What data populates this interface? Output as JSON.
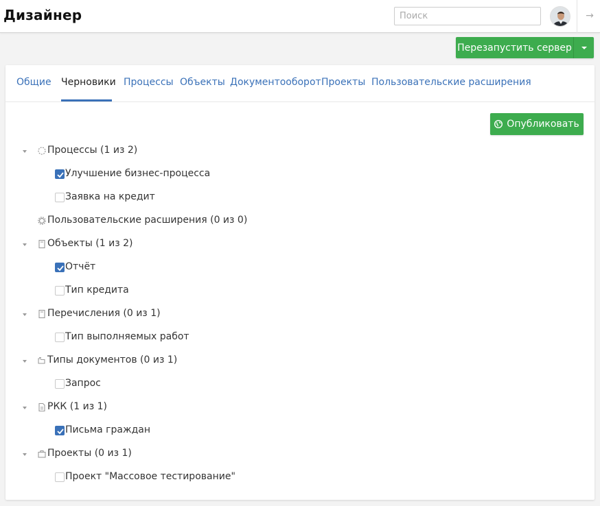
{
  "header": {
    "title": "Дизайнер",
    "search_placeholder": "Поиск"
  },
  "toolbar": {
    "restart_label": "Перезапустить сервер"
  },
  "tabs": [
    {
      "label": "Общие",
      "active": false
    },
    {
      "label": "Черновики",
      "active": true
    },
    {
      "label": "Процессы",
      "active": false
    },
    {
      "label": "Объекты",
      "active": false
    },
    {
      "label": "Документооборот",
      "active": false
    },
    {
      "label": "Проекты",
      "active": false
    },
    {
      "label": "Пользовательские расширения",
      "active": false
    }
  ],
  "publish_label": "Опубликовать",
  "tree": [
    {
      "label": "Процессы (1 из 2)",
      "icon": "process-icon",
      "items": [
        {
          "label": "Улучшение бизнес-процесса",
          "checked": true
        },
        {
          "label": "Заявка на кредит",
          "checked": false
        }
      ]
    },
    {
      "label": "Пользовательские расширения (0 из 0)",
      "icon": "gear-icon",
      "items": []
    },
    {
      "label": "Объекты (1 из 2)",
      "icon": "object-icon",
      "items": [
        {
          "label": "Отчёт",
          "checked": true
        },
        {
          "label": "Тип кредита",
          "checked": false
        }
      ]
    },
    {
      "label": "Перечисления (0 из 1)",
      "icon": "enum-icon",
      "items": [
        {
          "label": "Тип выполняемых работ",
          "checked": false
        }
      ]
    },
    {
      "label": "Типы документов (0 из 1)",
      "icon": "folder-icon",
      "items": [
        {
          "label": "Запрос",
          "checked": false
        }
      ]
    },
    {
      "label": "РКК (1 из 1)",
      "icon": "document-icon",
      "items": [
        {
          "label": "Письма граждан",
          "checked": true
        }
      ]
    },
    {
      "label": "Проекты (0 из 1)",
      "icon": "briefcase-icon",
      "items": [
        {
          "label": "Проект \"Массовое тестирование\"",
          "checked": false
        }
      ]
    }
  ],
  "colors": {
    "accent": "#3a71b8",
    "success": "#3dac4e",
    "background": "#f3f3f3"
  }
}
